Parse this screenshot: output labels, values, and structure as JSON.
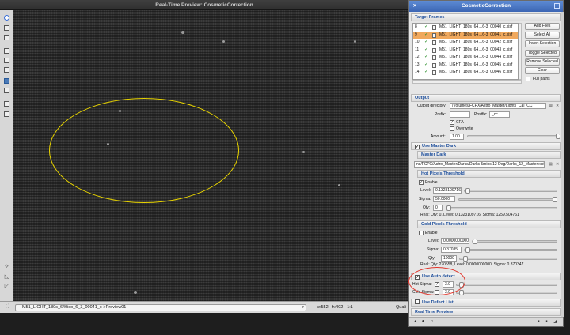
{
  "preview": {
    "title": "Real-Time Preview: CosmeticCorrection",
    "view_selector": "M51_LIGHT_180s_640iso_6_3_00041_c->Preview01",
    "coords": "w:552 · h:402 · 1:1",
    "quality": "Quali"
  },
  "dialog": {
    "title": "CosmeticCorrection",
    "target_frames": {
      "section": "Target Frames",
      "rows": [
        {
          "num": "8",
          "name": "M51_LIGHT_180s_64…6-3_00040_c.xisf",
          "selected": false
        },
        {
          "num": "9",
          "name": "M51_LIGHT_180s_64…6-3_00041_c.xisf",
          "selected": true
        },
        {
          "num": "10",
          "name": "M51_LIGHT_180s_64…6-3_00042_c.xisf",
          "selected": false
        },
        {
          "num": "11",
          "name": "M51_LIGHT_180s_64…6-3_00043_c.xisf",
          "selected": false
        },
        {
          "num": "12",
          "name": "M51_LIGHT_180s_64…6-3_00044_c.xisf",
          "selected": false
        },
        {
          "num": "13",
          "name": "M51_LIGHT_180s_64…6-3_00045_c.xisf",
          "selected": false
        },
        {
          "num": "14",
          "name": "M51_LIGHT_180s_64…6-3_00046_c.xisf",
          "selected": false
        }
      ],
      "buttons": {
        "add_files": "Add Files",
        "select_all": "Select All",
        "invert_selection": "Invert Selection",
        "toggle_selected": "Toggle Selected",
        "remove_selected": "Remove Selected",
        "clear": "Clear"
      },
      "full_paths": "Full paths"
    },
    "output": {
      "section": "Output",
      "dir_label": "Output directory:",
      "dir_value": "/Volumes/FCPX/Astro_Master/Lights_Cal_CC",
      "prefix_label": "Prefix:",
      "prefix_value": "",
      "postfix_label": "Postfix:",
      "postfix_value": "_cc",
      "cfa_label": "CFA",
      "overwrite_label": "Overwrite",
      "amount_label": "Amount:",
      "amount_value": "1.00"
    },
    "master_dark": {
      "section": "Use Master Dark",
      "subsection": "Master Dark",
      "path": "ns/FCPX/Astro_Master/Darks/Darks 5mins 12 Deg/Darks_12_Master.xisf"
    },
    "hot_pixels": {
      "section": "Hot Pixels Threshold",
      "enable_label": "Enable",
      "level_label": "Level:",
      "level_value": "0.1323109716",
      "sigma_label": "Sigma:",
      "sigma_value": "50.0000",
      "qty_label": "Qty:",
      "qty_value": "0",
      "info": "Real: Qty: 0, Level: 0.1323109716, Sigma: 1259.504761"
    },
    "cold_pixels": {
      "section": "Cold Pixels Threshold",
      "enable_label": "Enable",
      "level_label": "Level:",
      "level_value": "0.0000000000",
      "sigma_label": "Sigma:",
      "sigma_value": "0.37035",
      "qty_label": "Qty:",
      "qty_value": "10000",
      "info": "Real: Qty: 270558, Level: 0.0000000000, Sigma: 0.370347"
    },
    "auto_detect": {
      "section": "Use Auto detect",
      "hot_sigma_label": "Hot Sigma:",
      "hot_sigma_value": "3.0",
      "cold_sigma_label": "Cold Sigma:",
      "cold_sigma_value": "3.0"
    },
    "defect_list": {
      "section": "Use Defect List"
    },
    "real_time_preview": {
      "section": "Real Time Preview"
    },
    "accent_color": "#3c66b4",
    "highlight_color": "#f0a85c"
  }
}
